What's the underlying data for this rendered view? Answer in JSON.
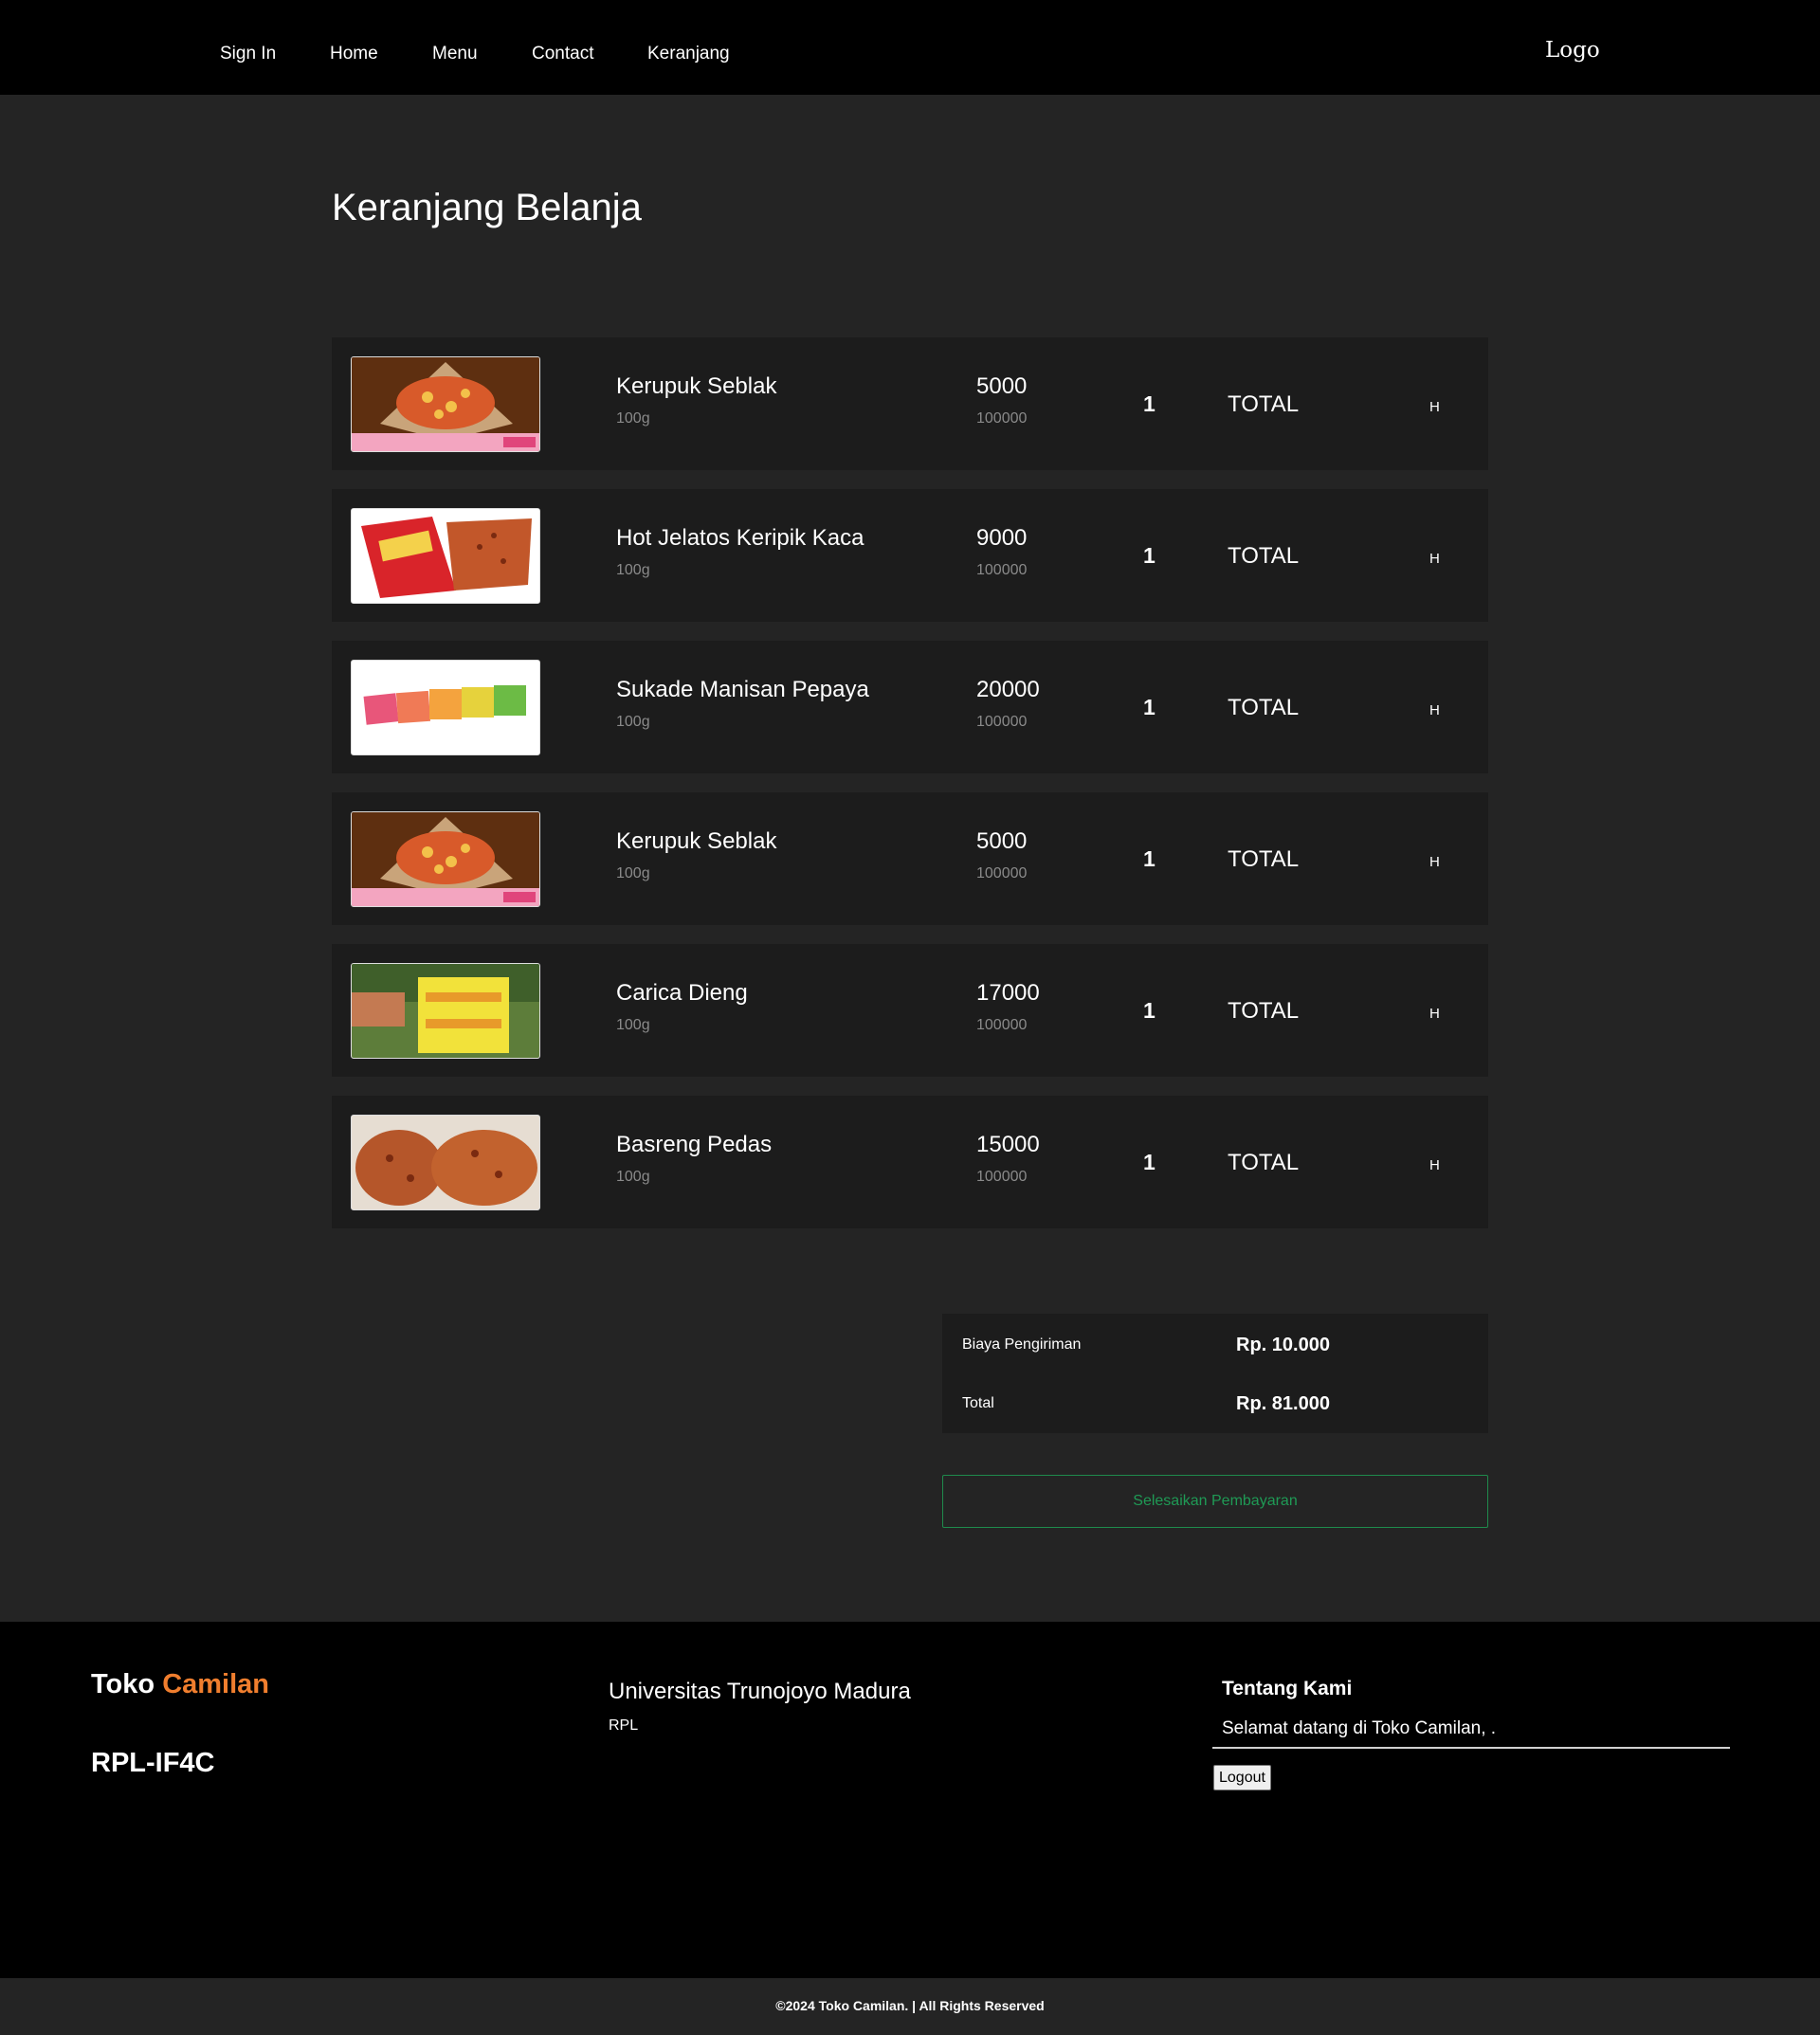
{
  "nav": {
    "links": [
      "Sign In",
      "Home",
      "Menu",
      "Contact",
      "Keranjang"
    ],
    "logo": "Logo"
  },
  "page": {
    "title": "Keranjang Belanja"
  },
  "cart": {
    "items": [
      {
        "name": "Kerupuk Seblak",
        "weight": "100g",
        "price": "5000",
        "stock": "100000",
        "qty": "1",
        "total": "TOTAL",
        "remove": "H",
        "image": "kerupuk-seblak-image"
      },
      {
        "name": "Hot Jelatos Keripik Kaca",
        "weight": "100g",
        "price": "9000",
        "stock": "100000",
        "qty": "1",
        "total": "TOTAL",
        "remove": "H",
        "image": "keripik-kaca-image"
      },
      {
        "name": "Sukade Manisan Pepaya",
        "weight": "100g",
        "price": "20000",
        "stock": "100000",
        "qty": "1",
        "total": "TOTAL",
        "remove": "H",
        "image": "sukade-image"
      },
      {
        "name": "Kerupuk Seblak",
        "weight": "100g",
        "price": "5000",
        "stock": "100000",
        "qty": "1",
        "total": "TOTAL",
        "remove": "H",
        "image": "kerupuk-seblak-image"
      },
      {
        "name": "Carica Dieng",
        "weight": "100g",
        "price": "17000",
        "stock": "100000",
        "qty": "1",
        "total": "TOTAL",
        "remove": "H",
        "image": "carica-image"
      },
      {
        "name": "Basreng Pedas",
        "weight": "100g",
        "price": "15000",
        "stock": "100000",
        "qty": "1",
        "total": "TOTAL",
        "remove": "H",
        "image": "basreng-image"
      }
    ]
  },
  "summary": {
    "shipping_label": "Biaya Pengiriman",
    "shipping_value": "Rp. 10.000",
    "total_label": "Total",
    "total_value": "Rp. 81.000",
    "pay_button": "Selesaikan Pembayaran"
  },
  "footer": {
    "brand_prefix": "Toko",
    "brand_accent": "Camilan",
    "class_name": "RPL-IF4C",
    "university": "Universitas Trunojoyo Madura",
    "university_sub": "RPL",
    "about_title": "Tentang Kami",
    "about_text": "Selamat datang di Toko Camilan, .",
    "logout": "Logout",
    "copyright": "©2024 Toko Camilan. | All Rights Reserved"
  },
  "colors": {
    "accent_orange": "#f07e2e",
    "pay_green": "#1f9a55",
    "row_bg": "#1c1c1c",
    "page_bg": "#242424"
  }
}
